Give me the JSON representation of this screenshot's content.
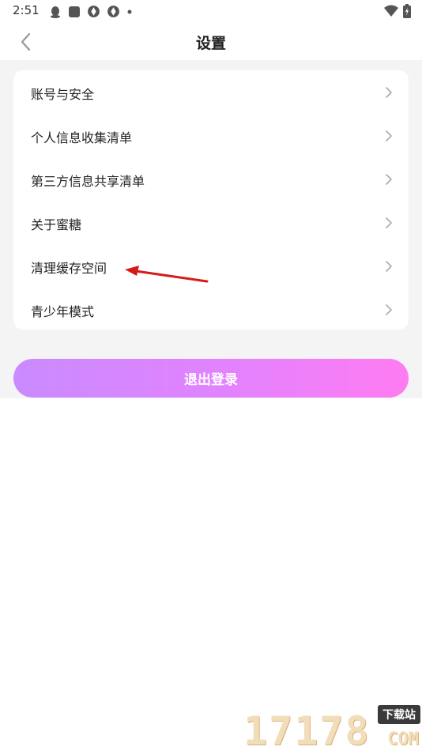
{
  "status_bar": {
    "time": "2:51",
    "icons": [
      "qq-icon",
      "app-square-icon",
      "aperture-icon",
      "aperture-icon",
      "dot-icon"
    ],
    "right_icons": [
      "wifi-icon",
      "battery-charging-icon"
    ]
  },
  "header": {
    "title": "设置",
    "back_icon": "chevron-left-icon"
  },
  "settings": {
    "items": [
      {
        "label": "账号与安全"
      },
      {
        "label": "个人信息收集清单"
      },
      {
        "label": "第三方信息共享清单"
      },
      {
        "label": "关于蜜糖"
      },
      {
        "label": "清理缓存空间"
      },
      {
        "label": "青少年模式"
      }
    ]
  },
  "logout": {
    "label": "退出登录"
  },
  "watermark": {
    "digits": "17178",
    "badge": "下载站",
    "suffix": "COM"
  },
  "colors": {
    "accent_start": "#c98bff",
    "accent_end": "#ff7cf2",
    "page_bg": "#f4f4f4",
    "annotation": "#d61a1a"
  }
}
